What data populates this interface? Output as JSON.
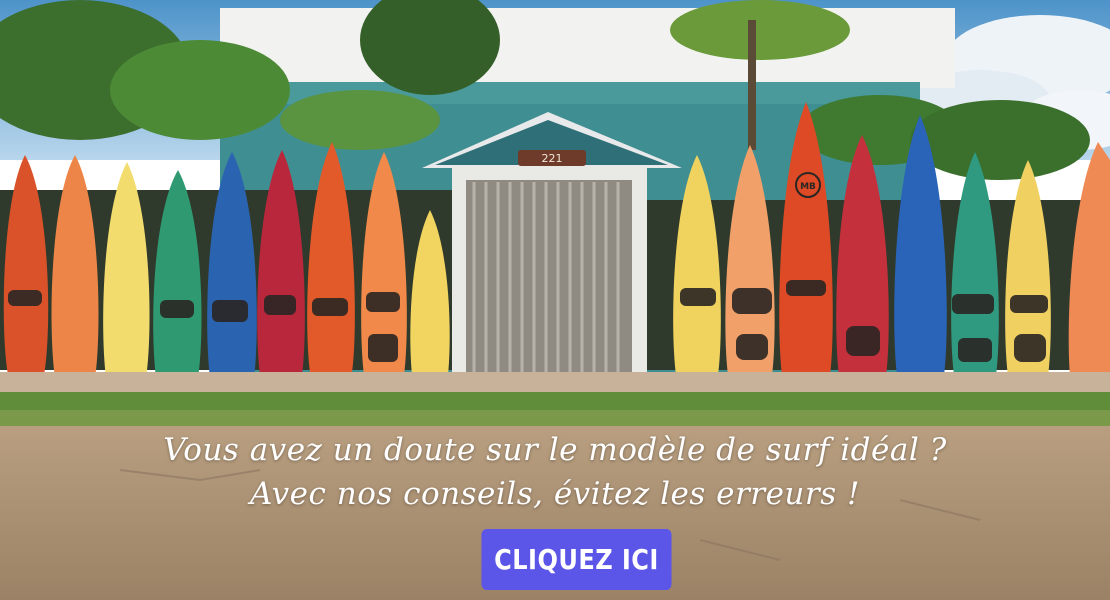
{
  "banner": {
    "line1": "Vous avez un doute sur le modèle de surf idéal ?",
    "line2": "Avec nos conseils, évitez les erreurs !",
    "cta_label": "CLIQUEZ ICI",
    "cta_color": "#5b55e8"
  },
  "scene": {
    "door_number": "221",
    "board_logo": "MB"
  }
}
